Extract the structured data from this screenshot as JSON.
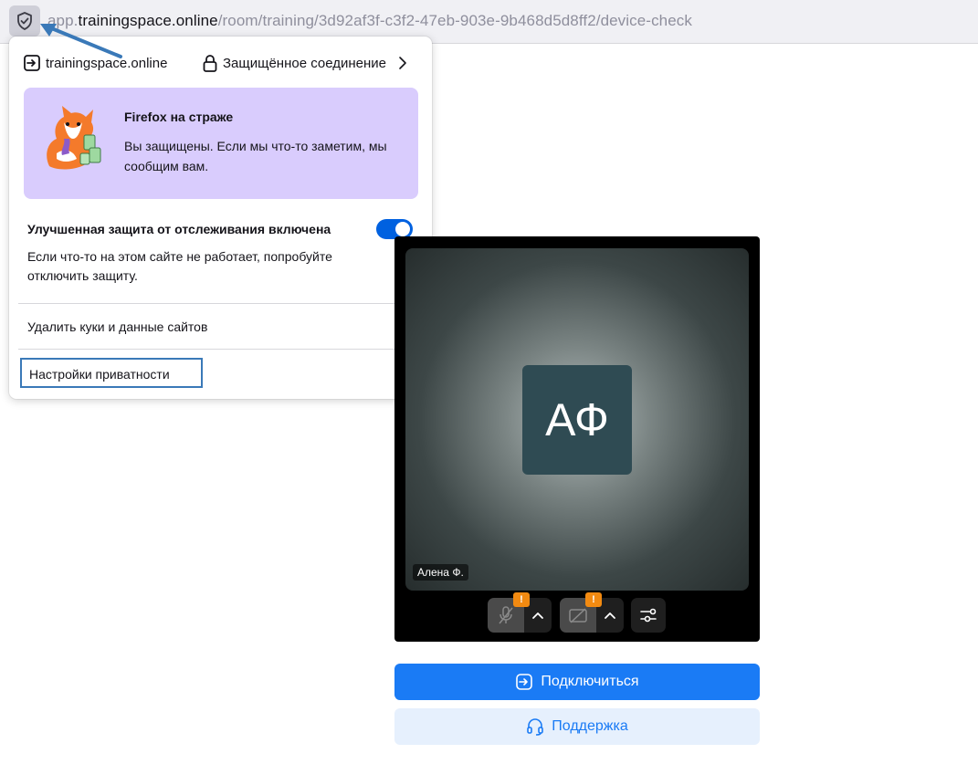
{
  "url": {
    "prefix": "app.",
    "host": "trainingspace.online",
    "path": "/room/training/3d92af3f-c3f2-47eb-903e-9b468d5d8ff2/device-check"
  },
  "panel": {
    "site_name": "trainingspace.online",
    "secure_label": "Защищённое соединение",
    "promo_title": "Firefox на страже",
    "promo_text": "Вы защищены. Если мы что-то заметим, мы сообщим вам.",
    "etp_title": "Улучшенная защита от отслеживания включена",
    "etp_enabled": true,
    "etp_text": "Если что-то на этом сайте не работает, попробуйте отключить защиту.",
    "clear_cookies_label": "Удалить куки и данные сайтов",
    "privacy_settings_label": "Настройки приватности"
  },
  "video": {
    "initials": "АФ",
    "participant_name": "Алена Ф.",
    "mic_warning": "!",
    "cam_warning": "!"
  },
  "buttons": {
    "connect_label": "Подключиться",
    "support_label": "Поддержка"
  },
  "colors": {
    "accent": "#1a7bf5",
    "toggle_on": "#0061e0",
    "promo_bg": "#d9ccfd",
    "warning": "#f28a11",
    "highlight_box": "#3a79b8"
  },
  "icons": [
    "shield-icon",
    "site-entry-icon",
    "lock-icon",
    "chevron-right-icon",
    "fox-illustration",
    "mic-off-icon",
    "camera-off-icon",
    "chevron-up-icon",
    "sliders-icon",
    "login-icon",
    "headset-icon"
  ]
}
